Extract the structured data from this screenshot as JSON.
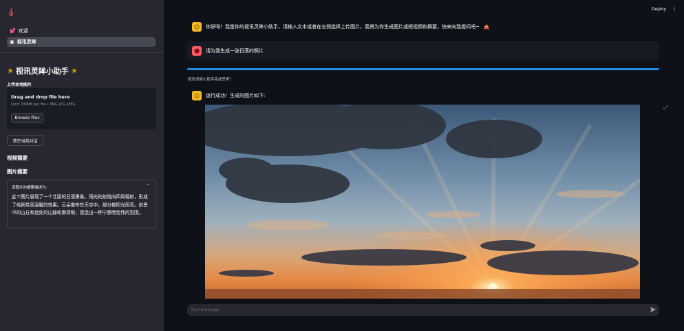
{
  "sidebar": {
    "nav": [
      {
        "icon": "💕",
        "label": "欢迎"
      },
      {
        "icon": "▣",
        "label": "视讯灵眸"
      }
    ],
    "title": "视讯灵眸小助手",
    "title_icon": "sun-icon",
    "upload_label": "上传本地图片",
    "dropzone": {
      "title": "Drag and drop file here",
      "hint": "Limit 200MB per file • PNG, JPG, JPEG",
      "browse_label": "Browse files"
    },
    "clear_label": "清空当前对话",
    "video_summary_heading": "视频摘要",
    "image_summary_heading": "图片摘要",
    "expander": {
      "header": "该图片的摘要描述为:",
      "body": "这个图片展现了一个壮丽的日落景象。阳光的射线向四周辐射，形成了戏剧性而温暖的效果。云朵散布在天空中，部分被阳光照亮。前景中的山丘和远处的山脉轮廓清晰，营造出一种宁静而宏伟的氛围。"
    }
  },
  "topbar": {
    "deploy_label": "Deploy",
    "menu_icon": "⋮"
  },
  "chat": {
    "greeting": "你好呀！我是你的视讯灵眸小助手，请输入文本或者在左侧选择上传图片，我将为你生成图片或短视频和摘要，快来向我提问吧~",
    "greeting_emoji": "🎪",
    "user_message": "请为我生成一张日落的照片",
    "progress": 1.0,
    "status_text": "视讯灵眸小助手完成思考！",
    "result_message": "运行成功！生成的图片如下:",
    "input_placeholder": "Your message"
  },
  "colors": {
    "sidebar_bg": "#262730",
    "main_bg": "#0e1117",
    "accent_blue": "#1f8ce6",
    "bot_avatar": "#f5b922",
    "user_avatar": "#ff5a5f"
  }
}
